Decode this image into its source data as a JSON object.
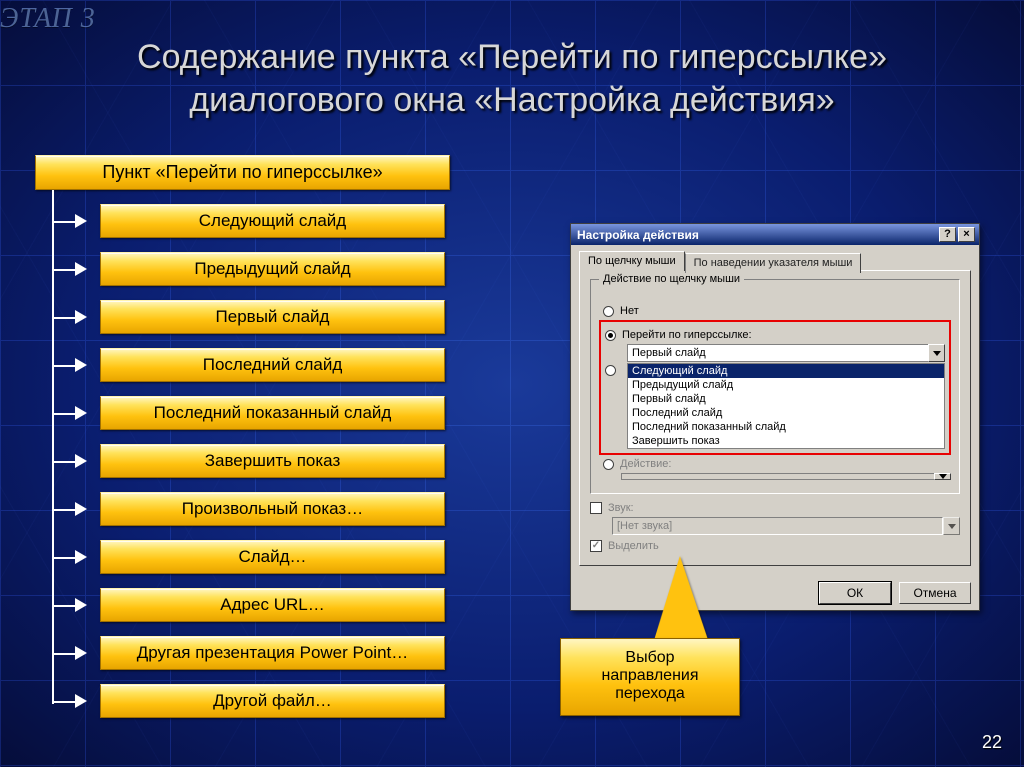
{
  "watermark": "ЭТАП 3",
  "title_line1": "Содержание пункта «Перейти по гиперссылке»",
  "title_line2": "диалогового окна «Настройка действия»",
  "page_number": "22",
  "tree": {
    "root": "Пункт «Перейти по гиперссылке»",
    "items": [
      "Следующий слайд",
      "Предыдущий слайд",
      "Первый слайд",
      "Последний слайд",
      "Последний показанный слайд",
      "Завершить показ",
      "Произвольный показ…",
      "Слайд…",
      "Адрес URL…",
      "Другая презентация Power Point…",
      "Другой файл…"
    ]
  },
  "dialog": {
    "title": "Настройка действия",
    "tabs": {
      "active": "По щелчку мыши",
      "inactive": "По наведении указателя мыши"
    },
    "group_label": "Действие по щелчку мыши",
    "radio_none": "Нет",
    "radio_hyperlink": "Перейти по гиперссылке:",
    "combo_value": "Первый слайд",
    "list": [
      "Следующий слайд",
      "Предыдущий слайд",
      "Первый слайд",
      "Последний слайд",
      "Последний показанный слайд",
      "Завершить показ"
    ],
    "radio_action": "Действие:",
    "chk_sound": "Звук:",
    "sound_value": "[Нет звука]",
    "chk_highlight": "Выделить",
    "btn_ok": "ОК",
    "btn_cancel": "Отмена"
  },
  "callout": {
    "line1": "Выбор",
    "line2": "направления",
    "line3": "перехода"
  }
}
